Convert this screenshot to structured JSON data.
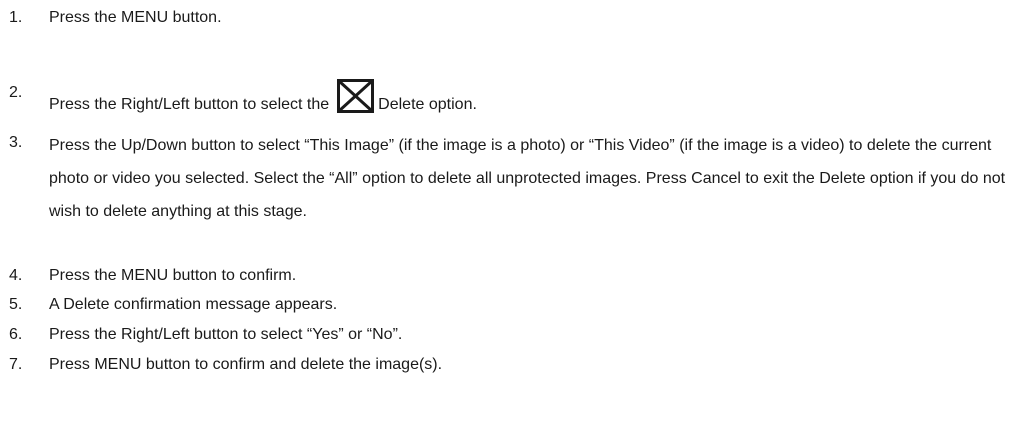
{
  "steps": [
    {
      "number": "1.",
      "text": "Press the MENU button."
    },
    {
      "number": "2.",
      "text_before": "Press the Right/Left button to select the",
      "icon": "delete-x-box-icon",
      "text_after": "Delete option."
    },
    {
      "number": "3.",
      "text": "Press the Up/Down button to select “This Image” (if the image is a photo) or “This Video” (if the image is a video) to delete the current photo or video you selected. Select the “All” option to delete all unprotected images. Press Cancel to exit the Delete option if you do not wish to delete anything at this stage."
    },
    {
      "number": "4.",
      "text": "Press the MENU button to confirm."
    },
    {
      "number": "5.",
      "text": "A Delete confirmation message appears."
    },
    {
      "number": "6.",
      "text": "Press the Right/Left button to select “Yes” or “No”."
    },
    {
      "number": "7.",
      "text": "Press MENU button to confirm and delete the image(s)."
    }
  ]
}
